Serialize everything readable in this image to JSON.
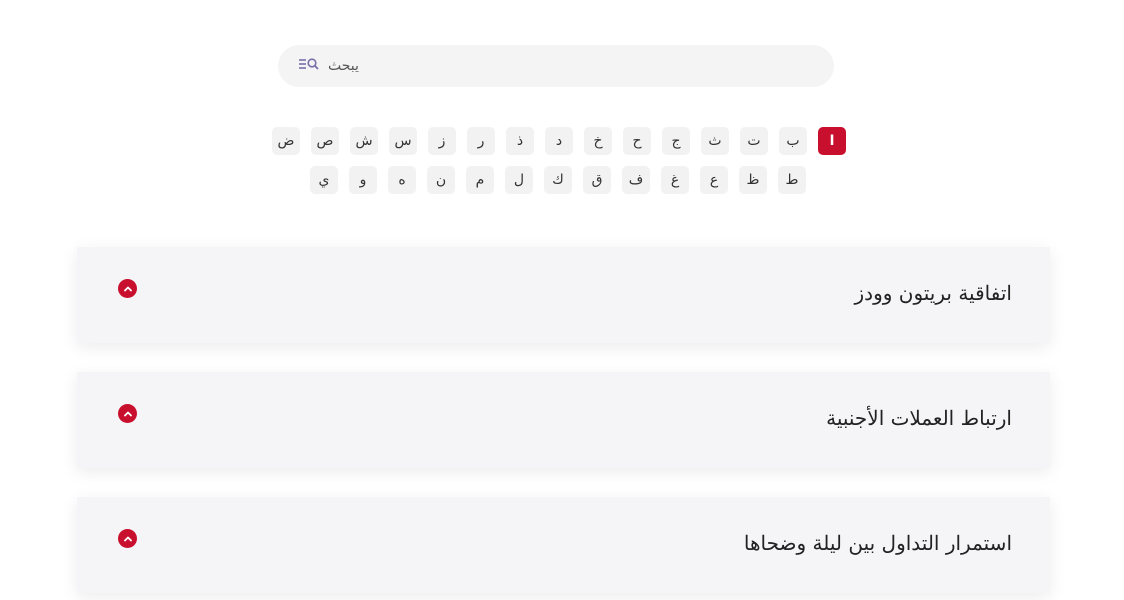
{
  "search": {
    "placeholder": "يبحث"
  },
  "letters": {
    "row1": [
      "ا",
      "ب",
      "ت",
      "ث",
      "ج",
      "ح",
      "خ",
      "د",
      "ذ",
      "ر",
      "ز",
      "س",
      "ش",
      "ص",
      "ض"
    ],
    "row2": [
      "ط",
      "ظ",
      "ع",
      "غ",
      "ف",
      "ق",
      "ك",
      "ل",
      "م",
      "ن",
      "ه",
      "و",
      "ي"
    ],
    "active": "ا"
  },
  "accordion": {
    "items": [
      {
        "title": "اتفاقية بريتون وودز"
      },
      {
        "title": "ارتباط العملات الأجنبية"
      },
      {
        "title": "استمرار التداول بين ليلة وضحاها"
      }
    ]
  },
  "colors": {
    "accent": "#c8102e",
    "card_bg": "#f5f5f7",
    "chip_bg": "#f2f2f2",
    "search_bg": "#f4f4f4"
  },
  "icons": {
    "search": "search-icon",
    "toggle": "chevron-up-icon"
  }
}
